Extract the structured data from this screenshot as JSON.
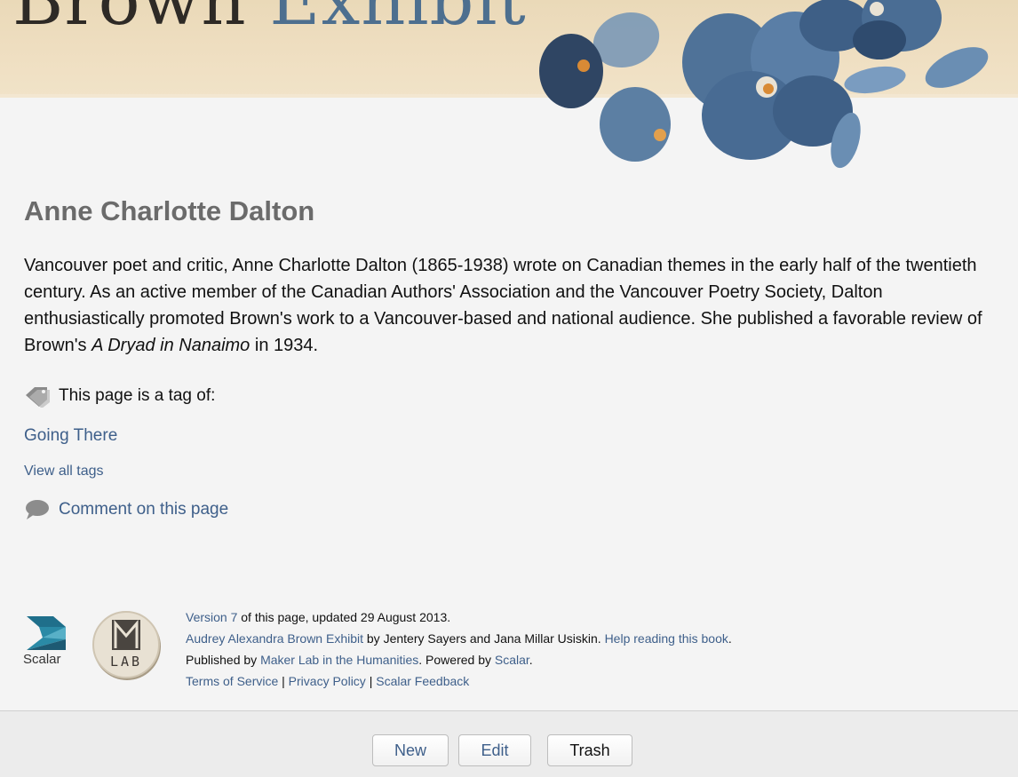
{
  "banner": {
    "title_part1": "Brown",
    "title_part2": "Exhibit"
  },
  "page": {
    "title": "Anne Charlotte Dalton",
    "body_text_1": "Vancouver poet and critic, Anne Charlotte Dalton (1865-1938) wrote on Canadian themes in the early half of the twentieth century. As an active member of the Canadian Authors' Association and the Vancouver Poetry Society, Dalton enthusiastically promoted Brown's work to a Vancouver-based and national audience. She published a favorable review of Brown's ",
    "body_italic": "A Dryad in Nanaimo",
    "body_text_2": " in 1934."
  },
  "tags": {
    "label": "This page is a tag of:",
    "items": [
      "Going There"
    ],
    "view_all": "View all tags"
  },
  "comment": {
    "label": "Comment on this page"
  },
  "footer": {
    "scalar_logo_text": "Scalar",
    "maker_lab_text": "LAB",
    "version_link": "Version 7",
    "version_suffix": " of this page, updated 29 August 2013.",
    "book_link": "Audrey Alexandra Brown Exhibit",
    "book_authors": " by Jentery Sayers and Jana Millar Usiskin. ",
    "help_link": "Help reading this book",
    "help_suffix": ".",
    "published_prefix": "Published by ",
    "publisher_link": "Maker Lab in the Humanities",
    "powered_prefix": ". Powered by ",
    "scalar_link": "Scalar",
    "powered_suffix": ".",
    "terms_link": "Terms of Service",
    "sep": " | ",
    "privacy_link": "Privacy Policy",
    "feedback_link": "Scalar Feedback"
  },
  "toolbar": {
    "new_label": "New",
    "edit_label": "Edit",
    "trash_label": "Trash"
  },
  "colors": {
    "link": "#3e5f8a",
    "title_gray": "#6b6b6b",
    "banner_blue": "#4d6f8f"
  }
}
